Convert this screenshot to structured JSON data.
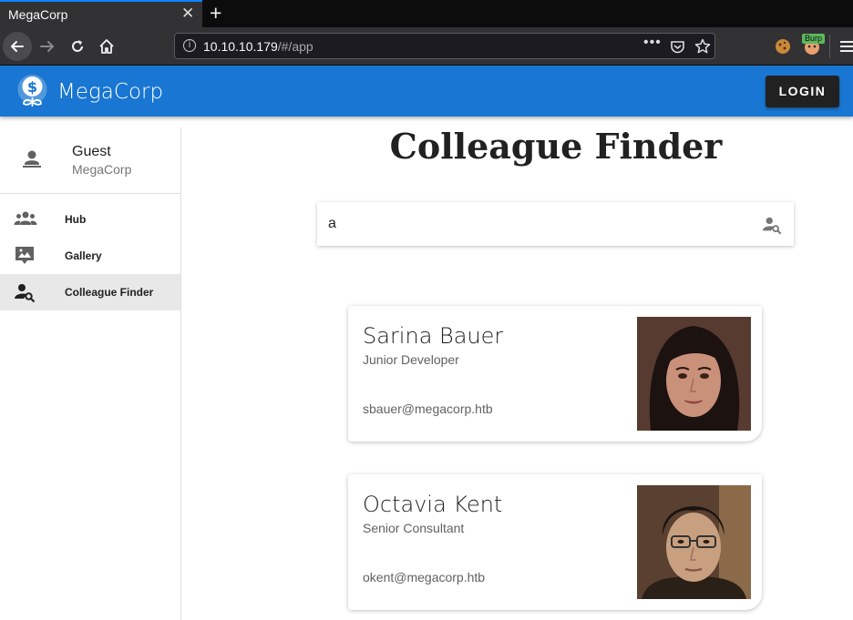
{
  "browser": {
    "tab_title": "MegaCorp",
    "close_glyph": "✕",
    "newtab_glyph": "+",
    "url_host": "10.10.10.179",
    "url_path": "/#/app",
    "burp_label": "Burp",
    "accent": "#0a84ff"
  },
  "app": {
    "brand": "MegaCorp",
    "login_label": "LOGIN",
    "appbar_color": "#1976d2"
  },
  "sidebar": {
    "user_name": "Guest",
    "user_org": "MegaCorp",
    "items": [
      {
        "label": "Hub",
        "icon": "people-icon"
      },
      {
        "label": "Gallery",
        "icon": "gallery-icon"
      },
      {
        "label": "Colleague Finder",
        "icon": "person-search-icon",
        "active": true
      }
    ]
  },
  "main": {
    "title": "Colleague Finder",
    "search_value": "a",
    "results": [
      {
        "name": "Sarina Bauer",
        "role": "Junior Developer",
        "email": "sbauer@megacorp.htb",
        "photo": "woman-portrait"
      },
      {
        "name": "Octavia Kent",
        "role": "Senior Consultant",
        "email": "okent@megacorp.htb",
        "photo": "man-portrait-glasses"
      }
    ]
  }
}
